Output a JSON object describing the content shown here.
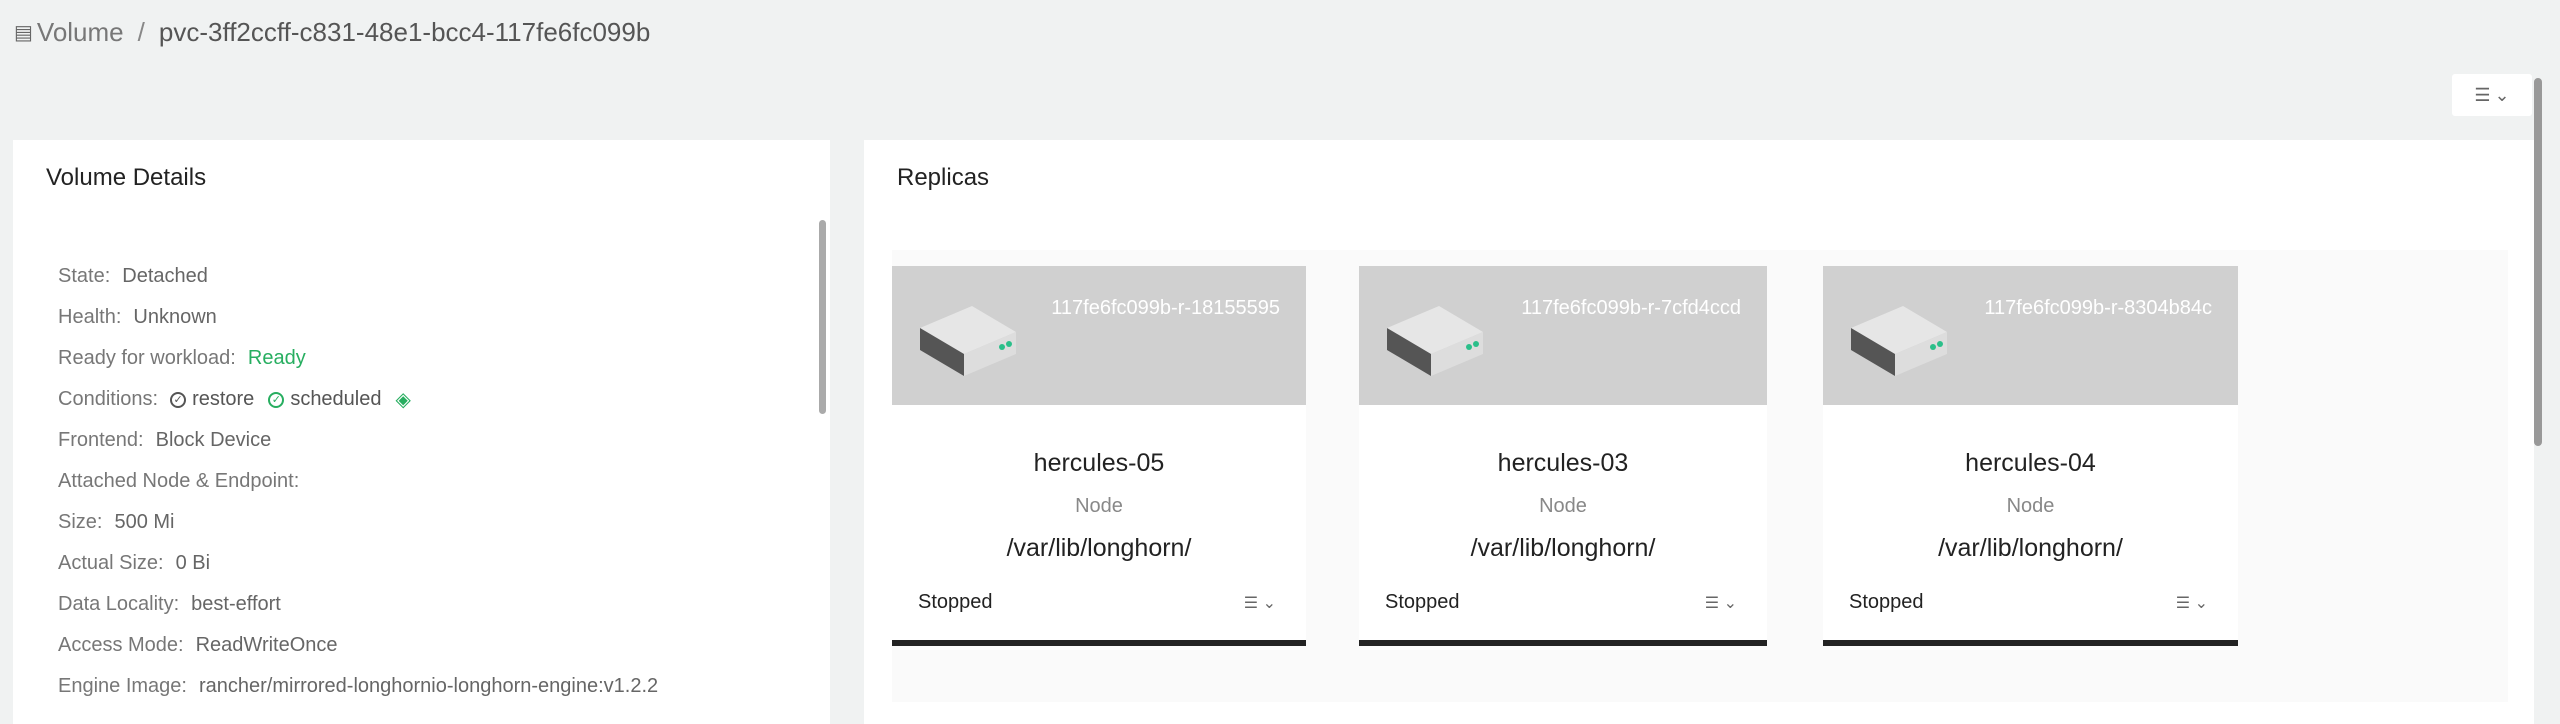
{
  "breadcrumb": {
    "icon": "volume-icon",
    "parent": "Volume",
    "separator": "/",
    "current": "pvc-3ff2ccff-c831-48e1-bcc4-117fe6fc099b"
  },
  "top_action": {
    "icon": "list-icon",
    "caret": "⌄"
  },
  "details": {
    "title": "Volume Details",
    "rows": {
      "state": {
        "label": "State:",
        "value": "Detached"
      },
      "health": {
        "label": "Health:",
        "value": "Unknown"
      },
      "ready": {
        "label": "Ready for workload:",
        "value": "Ready"
      },
      "conditions": {
        "label": "Conditions:",
        "restore": "restore",
        "scheduled": "scheduled"
      },
      "frontend": {
        "label": "Frontend:",
        "value": "Block Device"
      },
      "attached": {
        "label": "Attached Node & Endpoint:"
      },
      "size": {
        "label": "Size:",
        "value": "500 Mi"
      },
      "actual_size": {
        "label": "Actual Size:",
        "value": "0 Bi"
      },
      "data_locality": {
        "label": "Data Locality:",
        "value": "best-effort"
      },
      "access_mode": {
        "label": "Access Mode:",
        "value": "ReadWriteOnce"
      },
      "engine_image": {
        "label": "Engine Image:",
        "value": "rancher/mirrored-longhornio-longhorn-engine:v1.2.2"
      }
    }
  },
  "replicas": {
    "title": "Replicas",
    "items": [
      {
        "id": "117fe6fc099b-r-18155595",
        "node": "hercules-05",
        "node_label": "Node",
        "path": "/var/lib/longhorn/",
        "status": "Stopped"
      },
      {
        "id": "117fe6fc099b-r-7cfd4ccd",
        "node": "hercules-03",
        "node_label": "Node",
        "path": "/var/lib/longhorn/",
        "status": "Stopped"
      },
      {
        "id": "117fe6fc099b-r-8304b84c",
        "node": "hercules-04",
        "node_label": "Node",
        "path": "/var/lib/longhorn/",
        "status": "Stopped"
      }
    ]
  },
  "colors": {
    "accent": "#27ae60",
    "card_band": "#d0d0d0",
    "background": "#f0f2f2"
  }
}
